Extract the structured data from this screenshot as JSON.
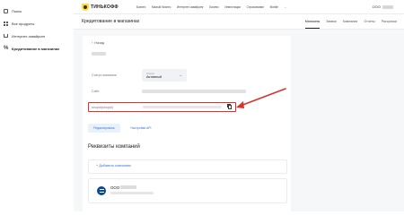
{
  "sidebar": {
    "items": [
      {
        "icon": "house-icon",
        "label": "Поиск"
      },
      {
        "icon": "grid-icon",
        "label": "Все продукты"
      },
      {
        "icon": "cart-icon",
        "label": "Интернет-эквайринг"
      },
      {
        "icon": "percent-icon",
        "label": "Кредитование в магазинах"
      }
    ]
  },
  "topnav": {
    "logo_text": "ТИНЬКОФФ",
    "menu": [
      "Бизнес",
      "Малый бизнес",
      "Интернет-эквайринг",
      "Бизнес",
      "Инвестиции",
      "Страхование",
      "Mobile",
      "..."
    ],
    "account_name": "ООО"
  },
  "header": {
    "page_title": "Кредитование в магазинах",
    "tabs": [
      "Магазины",
      "Заявки",
      "Компании",
      "Отчеты",
      "Рассрочки"
    ],
    "active_tab": 0
  },
  "card": {
    "back_label": "Назад",
    "status_label": "Статус магазина",
    "status_select_label": "Статус",
    "status_value": "Активный",
    "site_label": "Сайт",
    "shopid_label": "shopId(shopid)",
    "edit_button": "Редактировать",
    "api_button": "Настройки API",
    "company_section_title": "Реквизиты компаний",
    "add_company_link": "+ Добавить компанию",
    "company_name": "ООО"
  },
  "colors": {
    "accent": "#3a6fd8",
    "highlight_box": "#d9322c",
    "brand_yellow": "#ffdd2d"
  }
}
